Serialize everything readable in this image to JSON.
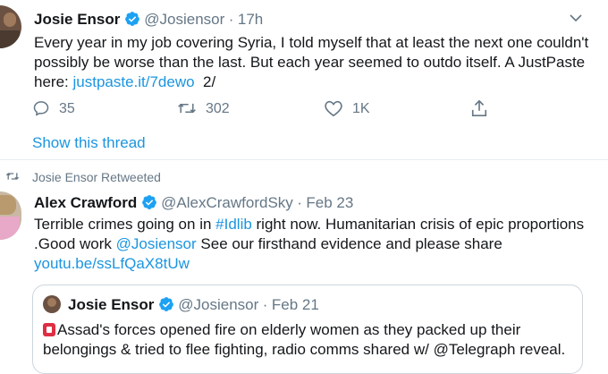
{
  "tweet1": {
    "name": "Josie Ensor",
    "handle": "@Josiensor",
    "sep": "·",
    "time": "17h",
    "text_line1": "Every year in my job covering Syria, I told myself that at least the next one couldn't",
    "text_line2": "possibly be worse than the last. But each year seemed to outdo itself. A JustPaste",
    "text_line3_prefix": "here: ",
    "link": "justpaste.it/7dewo",
    "suffix": "2/",
    "replies": "35",
    "retweets": "302",
    "likes": "1K",
    "show_thread": "Show this thread"
  },
  "retweet_notice": "Josie Ensor Retweeted",
  "tweet2": {
    "name": "Alex Crawford",
    "handle": "@AlexCrawfordSky",
    "sep": "·",
    "time": "Feb 23",
    "line1_a": "Terrible crimes going on in ",
    "hashtag": "#Idlib",
    "line1_b": " right now. Humanitarian crisis of epic proportions",
    "line2_a": ".Good work ",
    "mention": "@Josiensor",
    "line2_b": " See our firsthand evidence and please share",
    "link": "youtu.be/ssLfQaX8tUw"
  },
  "quoted": {
    "name": "Josie Ensor",
    "handle": "@Josiensor",
    "sep": "·",
    "time": "Feb 21",
    "line1": "Assad's forces opened fire on elderly women as they packed up their",
    "line2": "belongings & tried to flee fighting, radio comms shared w/ @Telegraph reveal."
  },
  "icons": {
    "verified_color": "#1da1f2",
    "accent": "#1b95e0",
    "muted": "#657786"
  }
}
